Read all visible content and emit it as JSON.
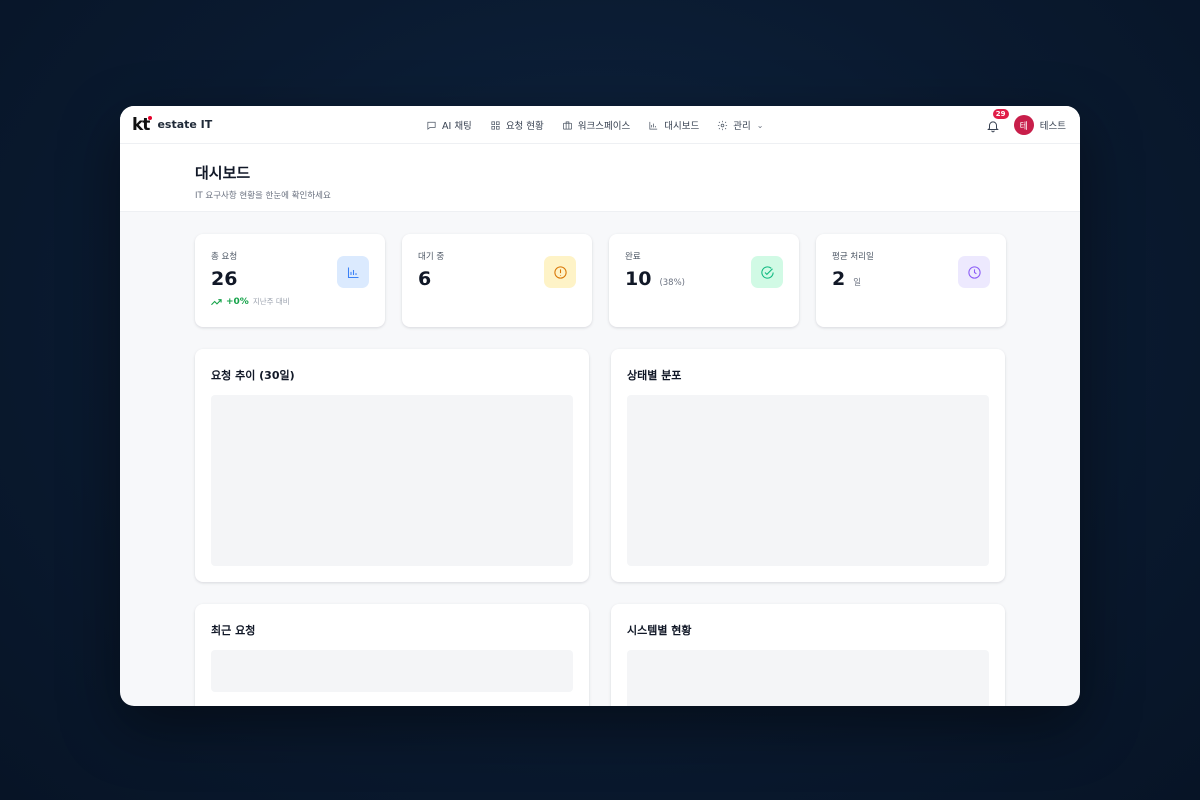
{
  "brand": {
    "name": "estate IT",
    "logo_text": "kt"
  },
  "nav": [
    {
      "label": "AI 채팅",
      "icon": "chat-icon"
    },
    {
      "label": "요청 현황",
      "icon": "grid-icon"
    },
    {
      "label": "워크스페이스",
      "icon": "briefcase-icon"
    },
    {
      "label": "대시보드",
      "icon": "bar-chart-icon"
    },
    {
      "label": "관리",
      "icon": "gear-icon"
    }
  ],
  "notifications": {
    "count": "29"
  },
  "user": {
    "avatar_text": "테",
    "name": "테스트"
  },
  "header": {
    "title": "대시보드",
    "subtitle": "IT 요구사항 현황을 한눈에 확인하세요"
  },
  "stats": [
    {
      "label": "총 요청",
      "value": "26",
      "trend": "+0%",
      "trend_note": "지난주 대비",
      "icon": "bar-chart-icon",
      "icon_bg": "#dbeafe",
      "icon_color": "#3b82f6"
    },
    {
      "label": "대기 중",
      "value": "6",
      "icon": "alert-circle-icon",
      "icon_bg": "#fef3c7",
      "icon_color": "#d97706"
    },
    {
      "label": "완료",
      "value": "10",
      "extra": "(38%)",
      "icon": "check-circle-icon",
      "icon_bg": "#d1fae5",
      "icon_color": "#10b981"
    },
    {
      "label": "평균 처리일",
      "value": "2",
      "extra": "일",
      "icon": "clock-icon",
      "icon_bg": "#ede9fe",
      "icon_color": "#8b5cf6"
    }
  ],
  "panels": {
    "trend": "요청 추이 (30일)",
    "status": "상태별 분포",
    "recent": "최근 요청",
    "system": "시스템별 현황"
  }
}
